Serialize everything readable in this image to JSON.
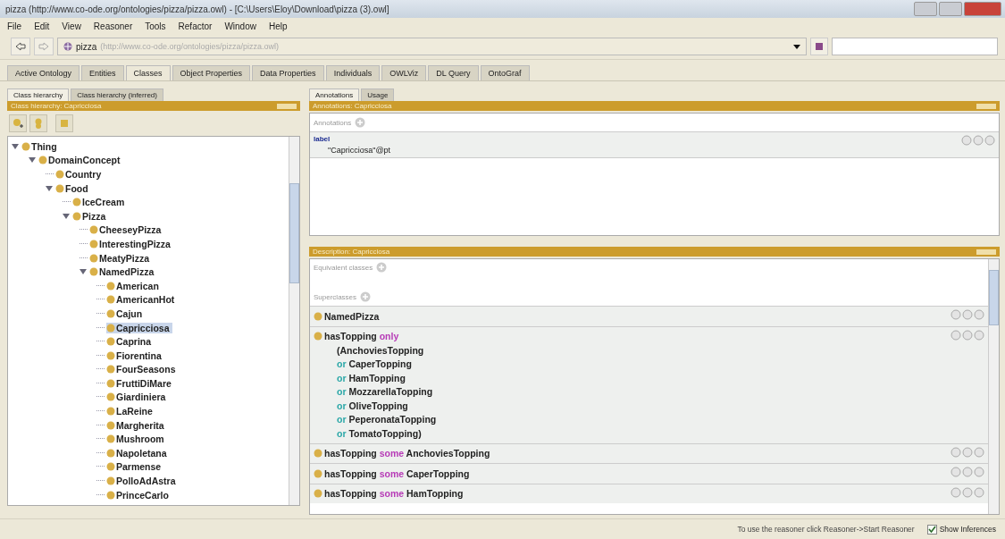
{
  "window": {
    "title": "pizza (http://www.co-ode.org/ontologies/pizza/pizza.owl) - [C:\\Users\\Eloy\\Download\\pizza (3).owl]"
  },
  "menu": [
    "File",
    "Edit",
    "View",
    "Reasoner",
    "Tools",
    "Refactor",
    "Window",
    "Help"
  ],
  "address": {
    "name": "pizza",
    "iri": "(http://www.co-ode.org/ontologies/pizza/pizza.owl)"
  },
  "tabs": [
    {
      "label": "Active Ontology",
      "selected": false
    },
    {
      "label": "Entities",
      "selected": false
    },
    {
      "label": "Classes",
      "selected": true
    },
    {
      "label": "Object Properties",
      "selected": false
    },
    {
      "label": "Data Properties",
      "selected": false
    },
    {
      "label": "Individuals",
      "selected": false
    },
    {
      "label": "OWLViz",
      "selected": false
    },
    {
      "label": "DL Query",
      "selected": false
    },
    {
      "label": "OntoGraf",
      "selected": false
    }
  ],
  "left": {
    "tabs": [
      {
        "label": "Class hierarchy",
        "selected": true
      },
      {
        "label": "Class hierarchy (inferred)",
        "selected": false
      }
    ],
    "header": "Class hierarchy: Capricciosa",
    "tree": [
      {
        "label": "Thing",
        "expanded": true,
        "selected": false,
        "children": [
          {
            "label": "DomainConcept",
            "expanded": true,
            "selected": false,
            "children": [
              {
                "label": "Country",
                "selected": false
              },
              {
                "label": "Food",
                "expanded": true,
                "selected": false,
                "children": [
                  {
                    "label": "IceCream",
                    "selected": false
                  },
                  {
                    "label": "Pizza",
                    "expanded": true,
                    "selected": false,
                    "children": [
                      {
                        "label": "CheeseyPizza",
                        "selected": false
                      },
                      {
                        "label": "InterestingPizza",
                        "selected": false
                      },
                      {
                        "label": "MeatyPizza",
                        "selected": false
                      },
                      {
                        "label": "NamedPizza",
                        "expanded": true,
                        "selected": false,
                        "children": [
                          {
                            "label": "American",
                            "selected": false
                          },
                          {
                            "label": "AmericanHot",
                            "selected": false
                          },
                          {
                            "label": "Cajun",
                            "selected": false
                          },
                          {
                            "label": "Capricciosa",
                            "selected": true
                          },
                          {
                            "label": "Caprina",
                            "selected": false
                          },
                          {
                            "label": "Fiorentina",
                            "selected": false
                          },
                          {
                            "label": "FourSeasons",
                            "selected": false
                          },
                          {
                            "label": "FruttiDiMare",
                            "selected": false
                          },
                          {
                            "label": "Giardiniera",
                            "selected": false
                          },
                          {
                            "label": "LaReine",
                            "selected": false
                          },
                          {
                            "label": "Margherita",
                            "selected": false
                          },
                          {
                            "label": "Mushroom",
                            "selected": false
                          },
                          {
                            "label": "Napoletana",
                            "selected": false
                          },
                          {
                            "label": "Parmense",
                            "selected": false
                          },
                          {
                            "label": "PolloAdAstra",
                            "selected": false
                          },
                          {
                            "label": "PrinceCarlo",
                            "selected": false
                          }
                        ]
                      }
                    ]
                  }
                ]
              }
            ]
          }
        ]
      }
    ]
  },
  "annotations": {
    "tabs": [
      {
        "label": "Annotations",
        "selected": true
      },
      {
        "label": "Usage",
        "selected": false
      }
    ],
    "header": "Annotations: Capricciosa",
    "section": "Annotations",
    "property": "label",
    "value": "\"Capricciosa\"@pt"
  },
  "description": {
    "header": "Description: Capricciosa",
    "sections": [
      {
        "title": "Equivalent classes"
      },
      {
        "title": "Superclasses",
        "rows": [
          {
            "lines": [
              [
                {
                  "kind": "class",
                  "text": "NamedPizza"
                }
              ]
            ]
          },
          {
            "lines": [
              [
                {
                  "kind": "class",
                  "text": "hasTopping"
                },
                {
                  "kind": "keyword",
                  "text": "only"
                }
              ],
              [
                {
                  "kind": "class",
                  "text": "(AnchoviesTopping"
                }
              ],
              [
                {
                  "kind": "connective",
                  "text": "or"
                },
                {
                  "kind": "class",
                  "text": "CaperTopping"
                }
              ],
              [
                {
                  "kind": "connective",
                  "text": "or"
                },
                {
                  "kind": "class",
                  "text": "HamTopping"
                }
              ],
              [
                {
                  "kind": "connective",
                  "text": "or"
                },
                {
                  "kind": "class",
                  "text": "MozzarellaTopping"
                }
              ],
              [
                {
                  "kind": "connective",
                  "text": "or"
                },
                {
                  "kind": "class",
                  "text": "OliveTopping"
                }
              ],
              [
                {
                  "kind": "connective",
                  "text": "or"
                },
                {
                  "kind": "class",
                  "text": "PeperonataTopping"
                }
              ],
              [
                {
                  "kind": "connective",
                  "text": "or"
                },
                {
                  "kind": "class",
                  "text": "TomatoTopping)"
                }
              ]
            ]
          },
          {
            "lines": [
              [
                {
                  "kind": "class",
                  "text": "hasTopping"
                },
                {
                  "kind": "keyword",
                  "text": "some"
                },
                {
                  "kind": "class",
                  "text": "AnchoviesTopping"
                }
              ]
            ]
          },
          {
            "lines": [
              [
                {
                  "kind": "class",
                  "text": "hasTopping"
                },
                {
                  "kind": "keyword",
                  "text": "some"
                },
                {
                  "kind": "class",
                  "text": "CaperTopping"
                }
              ]
            ]
          },
          {
            "lines": [
              [
                {
                  "kind": "class",
                  "text": "hasTopping"
                },
                {
                  "kind": "keyword",
                  "text": "some"
                },
                {
                  "kind": "class",
                  "text": "HamTopping"
                }
              ]
            ]
          }
        ]
      }
    ]
  },
  "status_bar": {
    "message": "To use the reasoner click Reasoner->Start Reasoner",
    "show_inferences": {
      "label": "Show Inferences",
      "checked": true
    }
  }
}
